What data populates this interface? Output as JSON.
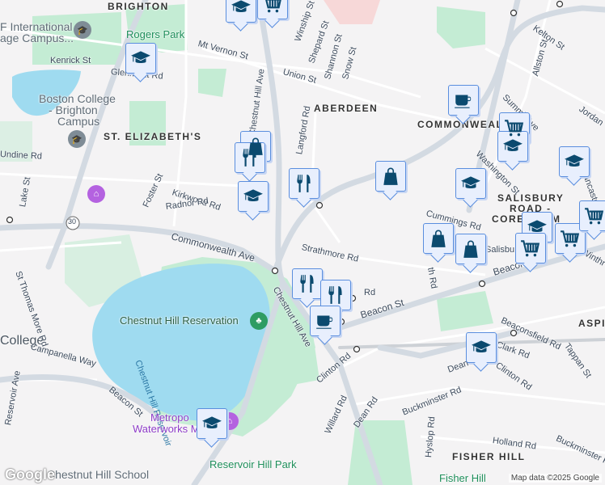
{
  "map": {
    "neighborhoods": [
      "BRIGHTON",
      "ABERDEEN",
      "COMMONWEALTH",
      "ST. ELIZABETH'S",
      "SALISBURY",
      "ROAD -",
      "CORE FARM",
      "ASPI",
      "FISHER HILL"
    ],
    "parks": [
      "Rogers Park",
      "Chestnut Hill Reservation",
      "Reservoir Hill Park",
      "Fisher Hill"
    ],
    "water": [
      "Chestnut Hill Reservoir"
    ],
    "places": [
      "F International",
      "age Campus...",
      "Boston College",
      "- Brighton",
      "Campus",
      "College",
      "Chestnut Hill School"
    ],
    "museum": [
      "Metropo",
      "Waterworks Mus"
    ],
    "streets": [
      "Kenrick St",
      "Glenmont Rd",
      "Mt Vernon St",
      "Winship St",
      "Shepard St",
      "Shannon St",
      "Snow St",
      "Union St",
      "Chestnut Hill Ave",
      "Kelton St",
      "Allston St",
      "Summit Ave",
      "Washington St",
      "Jordan",
      "Undine Rd",
      "Lake St",
      "Foster St",
      "Kirkwood Rd",
      "Radnor Rd",
      "Commonwealth Ave",
      "Strathmore Rd",
      "Cummings Rd",
      "Beacon St",
      "Beacon St",
      "Beaconsfield Rd",
      "Clark Rd",
      "Dean Rd",
      "Clinton Rd",
      "Clinton Rd",
      "Willard Rd",
      "Dean Rd",
      "Buckminster Rd",
      "Hyslop Rd",
      "Holland Rd",
      "Buckminster Rd",
      "Tappan St",
      "Winthr",
      "Lancaster",
      "St Thomas More Rd",
      "Campanella Way",
      "Beacon St",
      "Reservoir Ave",
      "Chestnut Hill Ave",
      "Langford Rd",
      "Salisbu",
      "th Rd",
      "Rd"
    ],
    "route_shield": "30",
    "credit": "Map data ©2025 Google",
    "logo": "Google"
  },
  "markers": [
    "graduation-cap",
    "graduation-cap",
    "shopping-cart",
    "restaurant",
    "restaurant",
    "graduation-cap",
    "restaurant",
    "shopping-bag",
    "coffee",
    "shopping-cart",
    "graduation-cap",
    "graduation-cap",
    "graduation-cap",
    "shopping-bag",
    "shopping-bag",
    "graduation-cap",
    "shopping-cart",
    "shopping-cart",
    "shopping-cart",
    "restaurant",
    "restaurant",
    "coffee",
    "graduation-cap",
    "graduation-cap"
  ],
  "colors": {
    "marker_bg": "#e8effd",
    "marker_border": "#5a8ede",
    "icon": "#0b4a6f",
    "water": "#9fdbf0",
    "park": "#c4ecd4",
    "road": "#d3dae2"
  }
}
